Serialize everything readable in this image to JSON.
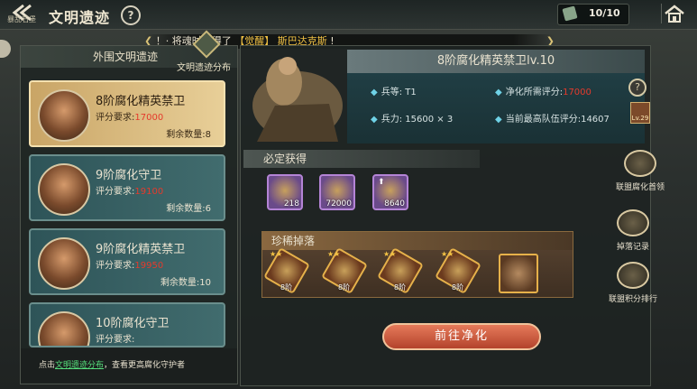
{
  "top": {
    "back_sub": "暴乱石堡",
    "title": "文明遗迹",
    "help": "?",
    "ticket_count": "10/10"
  },
  "marquee": {
    "prefix": "！· 将魂时获得了",
    "tag": "【觉醒】",
    "name": "斯巴达克斯",
    "suffix": "!"
  },
  "left": {
    "header": "外围文明遗迹",
    "dist_label": "文明遗迹分布",
    "cards": [
      {
        "name": "8阶腐化精英禁卫",
        "req_label": "评分要求:",
        "req_value": "17000",
        "remain": "剩余数量:8"
      },
      {
        "name": "9阶腐化守卫",
        "req_label": "评分要求:",
        "req_value": "19100",
        "remain": "剩余数量:6"
      },
      {
        "name": "9阶腐化精英禁卫",
        "req_label": "评分要求:",
        "req_value": "19950",
        "remain": "剩余数量:10"
      },
      {
        "name": "10阶腐化守卫",
        "req_label": "评分要求:",
        "req_value": "",
        "remain": ""
      }
    ],
    "footer_pre": "点击",
    "footer_link": "文明遗迹分布",
    "footer_post": "，查看更高腐化守护者"
  },
  "boss": {
    "title": "8阶腐化精英禁卫lv.10",
    "rank_label": "兵等:",
    "rank_value": "T1",
    "power_label": "兵力:",
    "power_value": "15600 × 3",
    "score_label": "净化所需评分:",
    "score_value": "17000",
    "team_label": "当前最高队伍评分:",
    "team_value": "14607",
    "level_badge": "Lv.29"
  },
  "must": {
    "header": "必定获得",
    "items": [
      {
        "icon": "coin-medal-icon",
        "count": "218"
      },
      {
        "icon": "gold-coins-icon",
        "count": "72000"
      },
      {
        "icon": "gold-coins-up-icon",
        "count": "8640"
      }
    ]
  },
  "rare": {
    "header": "珍稀掉落",
    "drops": [
      {
        "icon": "scroll-drop-icon",
        "stars": "★★",
        "label": "8阶"
      },
      {
        "icon": "statue-drop-icon",
        "stars": "★★",
        "label": "8阶"
      },
      {
        "icon": "book-drop-icon",
        "stars": "★★",
        "label": "8阶"
      },
      {
        "icon": "horn-drop-icon",
        "stars": "★★",
        "label": "8阶"
      }
    ]
  },
  "side": {
    "leader": "联盟腐化首领",
    "drops_record": "掉落记录",
    "ranking": "联盟积分排行"
  },
  "purify_button": "前往净化",
  "colors": {
    "accent_red": "#e53a2c",
    "link_green": "#55e07c",
    "highlight_gold": "#f2c244"
  }
}
